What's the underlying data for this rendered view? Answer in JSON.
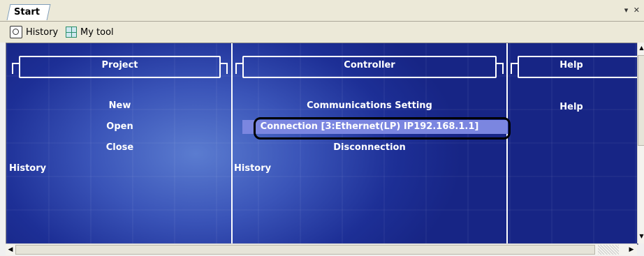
{
  "tab": {
    "label": "Start"
  },
  "toolbar": {
    "history_label": "History",
    "mytool_label": "My tool"
  },
  "sections": {
    "project": {
      "title": "Project",
      "links": [
        "New",
        "Open",
        "Close"
      ],
      "history_label": "History"
    },
    "controller": {
      "title": "Controller",
      "links": {
        "communications": "Communications Setting",
        "connection": "Connection [3:Ethernet(LP) IP192.168.1.1]",
        "disconnection": "Disconnection"
      },
      "history_label": "History"
    },
    "help": {
      "title": "Help",
      "links": [
        "Help"
      ]
    }
  },
  "colors": {
    "background_blue": "#1d2f96",
    "highlight": "#7b86e0",
    "text": "#ffffff"
  }
}
